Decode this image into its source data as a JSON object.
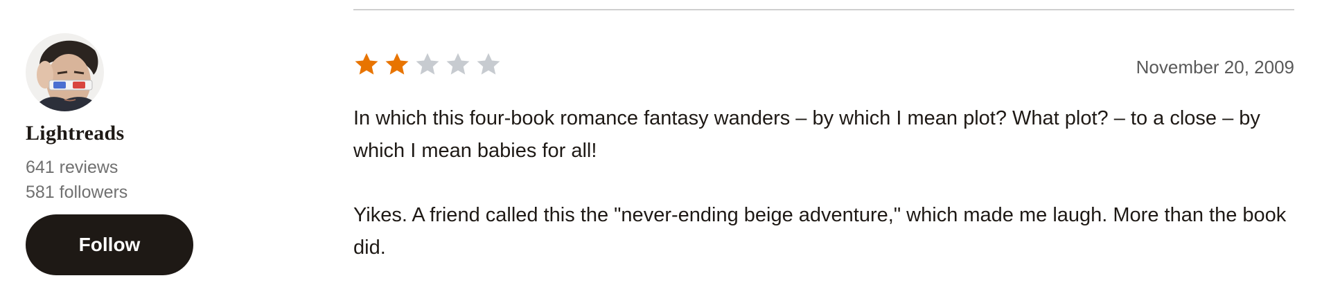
{
  "reviewer": {
    "name": "Lightreads",
    "reviews": "641 reviews",
    "followers": "581 followers",
    "follow_label": "Follow"
  },
  "review": {
    "rating": 2,
    "max_rating": 5,
    "date": "November 20, 2009",
    "paragraphs": [
      "In which this four-book romance fantasy wanders – by which I mean plot? What plot? – to a close – by which I mean babies for all!",
      "Yikes. A friend called this the \"never-ending beige adventure,\" which made me laugh. More than the book did."
    ]
  },
  "colors": {
    "star_filled": "#e87400",
    "star_empty": "#c7cbd0",
    "button_bg": "#1e1915",
    "divider": "#cfcfcf"
  },
  "icons": {
    "avatar": "reviewer-avatar",
    "star": "star-icon"
  }
}
